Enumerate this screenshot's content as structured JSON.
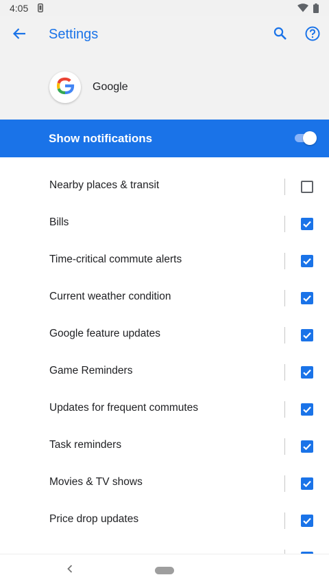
{
  "status_bar": {
    "time": "4:05",
    "icons": [
      "sim-card-icon",
      "wifi-icon",
      "battery-icon"
    ]
  },
  "header": {
    "title": "Settings",
    "app_name": "Google",
    "icons": {
      "back": "arrow-back-icon",
      "search": "search-icon",
      "help": "help-icon",
      "logo": "google-logo-icon"
    },
    "accent_color": "#1a73e8"
  },
  "notifications": {
    "label": "Show notifications",
    "enabled": true,
    "bar_color": "#1a73e8"
  },
  "channels": [
    {
      "label": "Nearby places & transit",
      "checked": false
    },
    {
      "label": "Bills",
      "checked": true
    },
    {
      "label": "Time-critical commute alerts",
      "checked": true
    },
    {
      "label": "Current weather condition",
      "checked": true
    },
    {
      "label": "Google feature updates",
      "checked": true
    },
    {
      "label": "Game Reminders",
      "checked": true
    },
    {
      "label": "Updates for frequent commutes",
      "checked": true
    },
    {
      "label": "Task reminders",
      "checked": true
    },
    {
      "label": "Movies & TV shows",
      "checked": true
    },
    {
      "label": "Price drop updates",
      "checked": true
    },
    {
      "label": "",
      "checked": true
    }
  ],
  "nav_bar": {
    "icons": [
      "nav-back-icon",
      "nav-home-pill"
    ]
  }
}
